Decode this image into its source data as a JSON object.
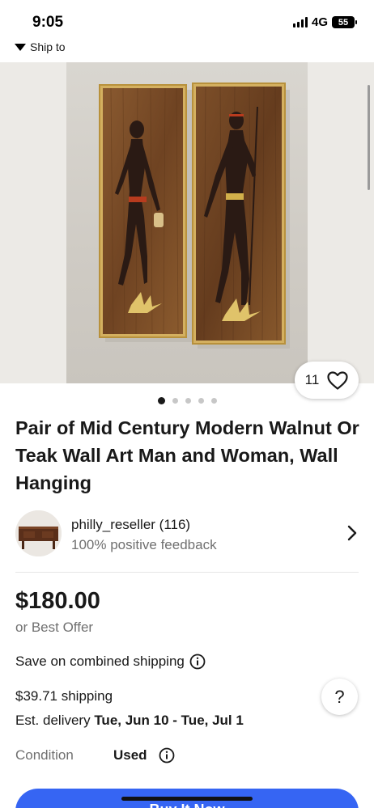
{
  "status": {
    "time": "9:05",
    "network": "4G",
    "battery": "55"
  },
  "header": {
    "ship_to": "Ship to"
  },
  "gallery": {
    "image_count": 5,
    "active_index": 0,
    "favorites_count": "11"
  },
  "listing": {
    "title": "Pair of Mid Century Modern Walnut Or Teak Wall Art Man and Woman, Wall Hanging",
    "price": "$180.00",
    "best_offer": "or Best Offer"
  },
  "seller": {
    "name": "philly_reseller (116)",
    "feedback": "100% positive feedback"
  },
  "shipping": {
    "combined_label": "Save on combined shipping",
    "cost": "$39.71 shipping",
    "est_label": "Est. delivery ",
    "est_dates": "Tue, Jun 10 - Tue, Jul 1"
  },
  "condition": {
    "label": "Condition",
    "value": "Used"
  },
  "actions": {
    "buy_now_label": "Buy It Now",
    "help_label": "?"
  },
  "colors": {
    "accent": "#3665f3",
    "text": "#191919",
    "muted": "#707070",
    "panel_wood": "#7a4d28",
    "frame_gold": "#c9a24a"
  }
}
